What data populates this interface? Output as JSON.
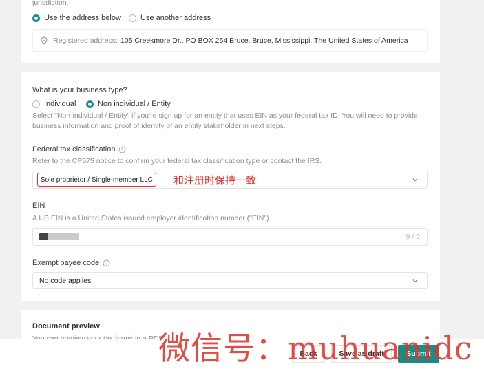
{
  "address_section": {
    "jurisdiction_tail": "jurisdiction.",
    "option_use_below": "Use the address below",
    "option_another": "Use another address",
    "registered_label": "Registered address:",
    "registered_value": "105 Creekmore Dr., PO BOX 254 Bruce, Bruce, Mississippi, The United States of America"
  },
  "business_section": {
    "question": "What is your business type?",
    "option_individual": "Individual",
    "option_entity": "Non individual / Entity",
    "selected": "Non individual / Entity",
    "help_text": "Select \"Non-individual / Entity\" if you're sign up for an entity that uses EIN as your federal tax ID. You will need to provide business information and proof of identity of an entity stakeholder in next steps.",
    "tax_class_label": "Federal tax classification",
    "tax_class_help": "Refer to the CP575 notice to confirm your federal tax classification type or contact the IRS.",
    "tax_class_value": "Sole proprietor / Single-member LLC",
    "annotation": "和注册时保持一致",
    "ein_label": "EIN",
    "ein_help": "A US EIN is a United States issued employer identification number (\"EIN\").",
    "ein_counter": "9 / 9",
    "exempt_label": "Exempt payee code",
    "exempt_value": "No code applies"
  },
  "preview_section": {
    "title": "Document preview",
    "sub_text": "You can preview your tax forms in a PDF"
  },
  "footer": {
    "back_label": "Back",
    "save_draft_label": "Save as draft",
    "submit_label": "Submit"
  },
  "watermark": "微信号：muhuanidc",
  "colors": {
    "accent": "#1a8c86",
    "annotation_red": "#e0312a"
  }
}
